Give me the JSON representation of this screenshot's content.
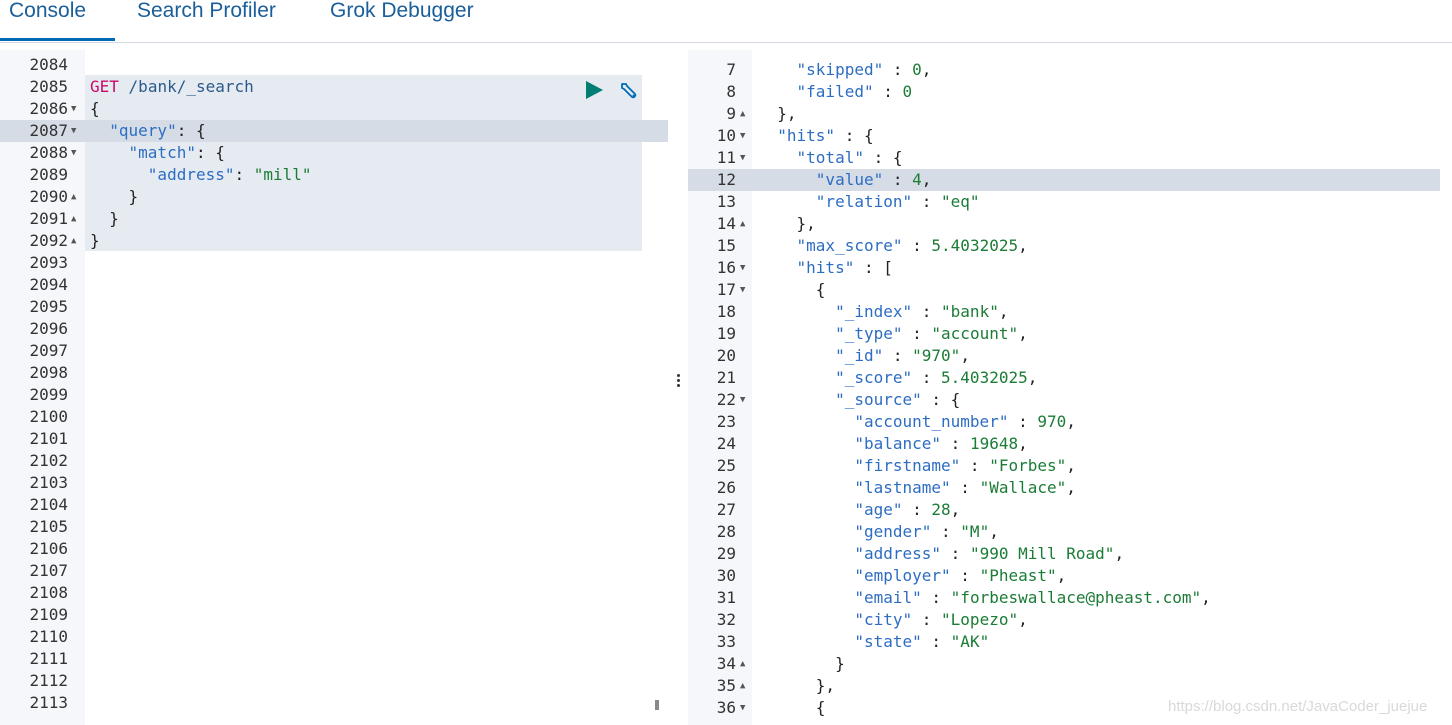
{
  "tabs": [
    {
      "label": "Console",
      "active": true
    },
    {
      "label": "Search Profiler",
      "active": false
    },
    {
      "label": "Grok Debugger",
      "active": false
    }
  ],
  "request": {
    "lines": [
      {
        "n": "2084",
        "fold": "",
        "tokens": []
      },
      {
        "n": "2085",
        "fold": "",
        "tokens": [
          [
            "m",
            "GET"
          ],
          [
            "p",
            " "
          ],
          [
            "u",
            "/bank/_search"
          ]
        ]
      },
      {
        "n": "2086",
        "fold": "▼",
        "tokens": [
          [
            "p",
            "{"
          ]
        ]
      },
      {
        "n": "2087",
        "fold": "▼",
        "tokens": [
          [
            "p",
            "  "
          ],
          [
            "k",
            "\"query\""
          ],
          [
            "p",
            ": {"
          ]
        ],
        "highlight": true
      },
      {
        "n": "2088",
        "fold": "▼",
        "tokens": [
          [
            "p",
            "    "
          ],
          [
            "k",
            "\"match\""
          ],
          [
            "p",
            ": {"
          ]
        ]
      },
      {
        "n": "2089",
        "fold": "",
        "tokens": [
          [
            "p",
            "      "
          ],
          [
            "k",
            "\"address\""
          ],
          [
            "p",
            ": "
          ],
          [
            "s",
            "\"mill\""
          ]
        ]
      },
      {
        "n": "2090",
        "fold": "▲",
        "tokens": [
          [
            "p",
            "    }"
          ]
        ]
      },
      {
        "n": "2091",
        "fold": "▲",
        "tokens": [
          [
            "p",
            "  }"
          ]
        ]
      },
      {
        "n": "2092",
        "fold": "▲",
        "tokens": [
          [
            "p",
            "}"
          ]
        ]
      },
      {
        "n": "2093",
        "fold": "",
        "tokens": []
      },
      {
        "n": "2094",
        "fold": "",
        "tokens": []
      },
      {
        "n": "2095",
        "fold": "",
        "tokens": []
      },
      {
        "n": "2096",
        "fold": "",
        "tokens": []
      },
      {
        "n": "2097",
        "fold": "",
        "tokens": []
      },
      {
        "n": "2098",
        "fold": "",
        "tokens": []
      },
      {
        "n": "2099",
        "fold": "",
        "tokens": []
      },
      {
        "n": "2100",
        "fold": "",
        "tokens": []
      },
      {
        "n": "2101",
        "fold": "",
        "tokens": []
      },
      {
        "n": "2102",
        "fold": "",
        "tokens": []
      },
      {
        "n": "2103",
        "fold": "",
        "tokens": []
      },
      {
        "n": "2104",
        "fold": "",
        "tokens": []
      },
      {
        "n": "2105",
        "fold": "",
        "tokens": []
      },
      {
        "n": "2106",
        "fold": "",
        "tokens": []
      },
      {
        "n": "2107",
        "fold": "",
        "tokens": []
      },
      {
        "n": "2108",
        "fold": "",
        "tokens": []
      },
      {
        "n": "2109",
        "fold": "",
        "tokens": []
      },
      {
        "n": "2110",
        "fold": "",
        "tokens": []
      },
      {
        "n": "2111",
        "fold": "",
        "tokens": []
      },
      {
        "n": "2112",
        "fold": "",
        "tokens": []
      },
      {
        "n": "2113",
        "fold": "",
        "tokens": []
      }
    ]
  },
  "response": {
    "lines": [
      {
        "n": "7",
        "fold": "",
        "tokens": [
          [
            "p",
            "    "
          ],
          [
            "k",
            "\"skipped\""
          ],
          [
            "p",
            " : "
          ],
          [
            "v",
            "0"
          ],
          [
            "p",
            ","
          ]
        ]
      },
      {
        "n": "8",
        "fold": "",
        "tokens": [
          [
            "p",
            "    "
          ],
          [
            "k",
            "\"failed\""
          ],
          [
            "p",
            " : "
          ],
          [
            "v",
            "0"
          ]
        ]
      },
      {
        "n": "9",
        "fold": "▲",
        "tokens": [
          [
            "p",
            "  },"
          ]
        ]
      },
      {
        "n": "10",
        "fold": "▼",
        "tokens": [
          [
            "p",
            "  "
          ],
          [
            "k",
            "\"hits\""
          ],
          [
            "p",
            " : {"
          ]
        ]
      },
      {
        "n": "11",
        "fold": "▼",
        "tokens": [
          [
            "p",
            "    "
          ],
          [
            "k",
            "\"total\""
          ],
          [
            "p",
            " : {"
          ]
        ]
      },
      {
        "n": "12",
        "fold": "",
        "tokens": [
          [
            "p",
            "      "
          ],
          [
            "k",
            "\"value\""
          ],
          [
            "p",
            " : "
          ],
          [
            "v",
            "4"
          ],
          [
            "p",
            ","
          ]
        ],
        "highlight": true
      },
      {
        "n": "13",
        "fold": "",
        "tokens": [
          [
            "p",
            "      "
          ],
          [
            "k",
            "\"relation\""
          ],
          [
            "p",
            " : "
          ],
          [
            "s",
            "\"eq\""
          ]
        ]
      },
      {
        "n": "14",
        "fold": "▲",
        "tokens": [
          [
            "p",
            "    },"
          ]
        ]
      },
      {
        "n": "15",
        "fold": "",
        "tokens": [
          [
            "p",
            "    "
          ],
          [
            "k",
            "\"max_score\""
          ],
          [
            "p",
            " : "
          ],
          [
            "v",
            "5.4032025"
          ],
          [
            "p",
            ","
          ]
        ]
      },
      {
        "n": "16",
        "fold": "▼",
        "tokens": [
          [
            "p",
            "    "
          ],
          [
            "k",
            "\"hits\""
          ],
          [
            "p",
            " : ["
          ]
        ]
      },
      {
        "n": "17",
        "fold": "▼",
        "tokens": [
          [
            "p",
            "      {"
          ]
        ]
      },
      {
        "n": "18",
        "fold": "",
        "tokens": [
          [
            "p",
            "        "
          ],
          [
            "k",
            "\"_index\""
          ],
          [
            "p",
            " : "
          ],
          [
            "s",
            "\"bank\""
          ],
          [
            "p",
            ","
          ]
        ]
      },
      {
        "n": "19",
        "fold": "",
        "tokens": [
          [
            "p",
            "        "
          ],
          [
            "k",
            "\"_type\""
          ],
          [
            "p",
            " : "
          ],
          [
            "s",
            "\"account\""
          ],
          [
            "p",
            ","
          ]
        ]
      },
      {
        "n": "20",
        "fold": "",
        "tokens": [
          [
            "p",
            "        "
          ],
          [
            "k",
            "\"_id\""
          ],
          [
            "p",
            " : "
          ],
          [
            "s",
            "\"970\""
          ],
          [
            "p",
            ","
          ]
        ]
      },
      {
        "n": "21",
        "fold": "",
        "tokens": [
          [
            "p",
            "        "
          ],
          [
            "k",
            "\"_score\""
          ],
          [
            "p",
            " : "
          ],
          [
            "v",
            "5.4032025"
          ],
          [
            "p",
            ","
          ]
        ]
      },
      {
        "n": "22",
        "fold": "▼",
        "tokens": [
          [
            "p",
            "        "
          ],
          [
            "k",
            "\"_source\""
          ],
          [
            "p",
            " : {"
          ]
        ]
      },
      {
        "n": "23",
        "fold": "",
        "tokens": [
          [
            "p",
            "          "
          ],
          [
            "k",
            "\"account_number\""
          ],
          [
            "p",
            " : "
          ],
          [
            "v",
            "970"
          ],
          [
            "p",
            ","
          ]
        ]
      },
      {
        "n": "24",
        "fold": "",
        "tokens": [
          [
            "p",
            "          "
          ],
          [
            "k",
            "\"balance\""
          ],
          [
            "p",
            " : "
          ],
          [
            "v",
            "19648"
          ],
          [
            "p",
            ","
          ]
        ]
      },
      {
        "n": "25",
        "fold": "",
        "tokens": [
          [
            "p",
            "          "
          ],
          [
            "k",
            "\"firstname\""
          ],
          [
            "p",
            " : "
          ],
          [
            "s",
            "\"Forbes\""
          ],
          [
            "p",
            ","
          ]
        ]
      },
      {
        "n": "26",
        "fold": "",
        "tokens": [
          [
            "p",
            "          "
          ],
          [
            "k",
            "\"lastname\""
          ],
          [
            "p",
            " : "
          ],
          [
            "s",
            "\"Wallace\""
          ],
          [
            "p",
            ","
          ]
        ]
      },
      {
        "n": "27",
        "fold": "",
        "tokens": [
          [
            "p",
            "          "
          ],
          [
            "k",
            "\"age\""
          ],
          [
            "p",
            " : "
          ],
          [
            "v",
            "28"
          ],
          [
            "p",
            ","
          ]
        ]
      },
      {
        "n": "28",
        "fold": "",
        "tokens": [
          [
            "p",
            "          "
          ],
          [
            "k",
            "\"gender\""
          ],
          [
            "p",
            " : "
          ],
          [
            "s",
            "\"M\""
          ],
          [
            "p",
            ","
          ]
        ]
      },
      {
        "n": "29",
        "fold": "",
        "tokens": [
          [
            "p",
            "          "
          ],
          [
            "k",
            "\"address\""
          ],
          [
            "p",
            " : "
          ],
          [
            "s",
            "\"990 Mill Road\""
          ],
          [
            "p",
            ","
          ]
        ]
      },
      {
        "n": "30",
        "fold": "",
        "tokens": [
          [
            "p",
            "          "
          ],
          [
            "k",
            "\"employer\""
          ],
          [
            "p",
            " : "
          ],
          [
            "s",
            "\"Pheast\""
          ],
          [
            "p",
            ","
          ]
        ]
      },
      {
        "n": "31",
        "fold": "",
        "tokens": [
          [
            "p",
            "          "
          ],
          [
            "k",
            "\"email\""
          ],
          [
            "p",
            " : "
          ],
          [
            "s",
            "\"forbeswallace@pheast.com\""
          ],
          [
            "p",
            ","
          ]
        ]
      },
      {
        "n": "32",
        "fold": "",
        "tokens": [
          [
            "p",
            "          "
          ],
          [
            "k",
            "\"city\""
          ],
          [
            "p",
            " : "
          ],
          [
            "s",
            "\"Lopezo\""
          ],
          [
            "p",
            ","
          ]
        ]
      },
      {
        "n": "33",
        "fold": "",
        "tokens": [
          [
            "p",
            "          "
          ],
          [
            "k",
            "\"state\""
          ],
          [
            "p",
            " : "
          ],
          [
            "s",
            "\"AK\""
          ]
        ]
      },
      {
        "n": "34",
        "fold": "▲",
        "tokens": [
          [
            "p",
            "        }"
          ]
        ]
      },
      {
        "n": "35",
        "fold": "▲",
        "tokens": [
          [
            "p",
            "      },"
          ]
        ]
      },
      {
        "n": "36",
        "fold": "▼",
        "tokens": [
          [
            "p",
            "      {"
          ]
        ]
      }
    ]
  },
  "watermark": "https://blog.csdn.net/JavaCoder_juejue",
  "colors": {
    "accent": "#006bb4",
    "run": "#017d73",
    "method": "#c80a68",
    "key": "#2d6dc2",
    "string": "#1b7c36"
  },
  "icons": {
    "run": "play-icon",
    "settings": "wrench-icon"
  }
}
